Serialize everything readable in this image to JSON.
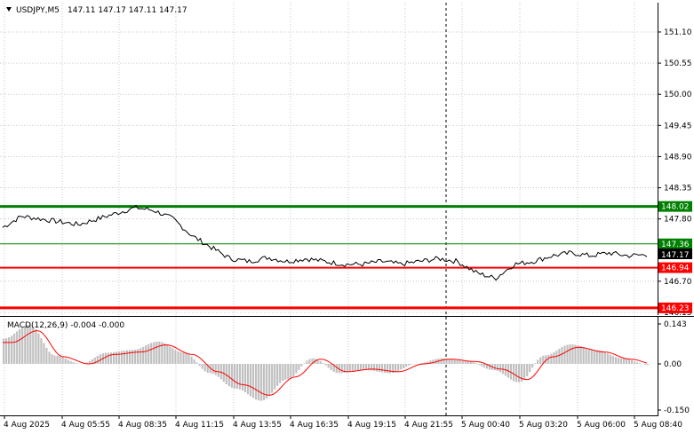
{
  "header": {
    "symbol": "USDJPY,M5",
    "ohlc": "147.11 147.17 147.11 147.17",
    "menu_icon": "triangle-down-icon"
  },
  "indicator": {
    "label": "MACD(12,26,9) -0.004 -0.000",
    "axis_labels": [
      "0.143",
      "0.00",
      "-0.150"
    ]
  },
  "price_axis": {
    "labels": [
      "151.10",
      "150.55",
      "150.00",
      "149.45",
      "148.90",
      "148.35",
      "147.80",
      "146.70",
      "146.15"
    ],
    "current_price": "147.17"
  },
  "levels": [
    {
      "label": "148.02",
      "color": "#008000",
      "width": 3
    },
    {
      "label": "147.36",
      "color": "#008000",
      "width": 1
    },
    {
      "label": "146.94",
      "color": "#ff0000",
      "width": 2
    },
    {
      "label": "146.23",
      "color": "#ff0000",
      "width": 3
    }
  ],
  "time_axis": {
    "labels": [
      "4 Aug 2025",
      "4 Aug 05:55",
      "4 Aug 08:35",
      "4 Aug 11:15",
      "4 Aug 13:55",
      "4 Aug 16:35",
      "4 Aug 19:15",
      "4 Aug 21:55",
      "5 Aug 00:40",
      "5 Aug 03:20",
      "5 Aug 06:00",
      "5 Aug 08:40"
    ]
  },
  "colors": {
    "price_line": "#000000",
    "histogram": "#c0c0c0",
    "signal": "#ff0000",
    "grid": "#c8c8c8",
    "separator": "#000000"
  },
  "chart_data": {
    "type": "line",
    "title": "USDJPY,M5",
    "ylim": [
      146.15,
      151.3
    ],
    "price_series_keypoints": [
      [
        0,
        147.65
      ],
      [
        1,
        147.85
      ],
      [
        2,
        147.8
      ],
      [
        3,
        147.75
      ],
      [
        4,
        147.7
      ],
      [
        5,
        147.8
      ],
      [
        6,
        147.9
      ],
      [
        7,
        148.0
      ],
      [
        8,
        147.95
      ],
      [
        9,
        147.8
      ],
      [
        10,
        147.5
      ],
      [
        11,
        147.3
      ],
      [
        12,
        147.1
      ],
      [
        13,
        147.05
      ],
      [
        14,
        147.12
      ],
      [
        15,
        147.05
      ],
      [
        16,
        147.1
      ],
      [
        17,
        147.05
      ],
      [
        18,
        147.0
      ],
      [
        19,
        147.0
      ],
      [
        20,
        147.05
      ],
      [
        21,
        147.0
      ],
      [
        22,
        147.05
      ],
      [
        23,
        147.1
      ],
      [
        24,
        147.05
      ],
      [
        25,
        146.85
      ],
      [
        26,
        146.75
      ],
      [
        27,
        147.0
      ],
      [
        28,
        147.05
      ],
      [
        29,
        147.15
      ],
      [
        30,
        147.2
      ],
      [
        31,
        147.15
      ],
      [
        32,
        147.2
      ],
      [
        33,
        147.15
      ],
      [
        34,
        147.17
      ]
    ],
    "macd_series_keypoints": [
      [
        0,
        0.09
      ],
      [
        1,
        0.14
      ],
      [
        2,
        0.03
      ],
      [
        3,
        0.0
      ],
      [
        4,
        0.04
      ],
      [
        5,
        0.05
      ],
      [
        6,
        0.08
      ],
      [
        7,
        0.04
      ],
      [
        8,
        -0.03
      ],
      [
        9,
        -0.08
      ],
      [
        10,
        -0.12
      ],
      [
        11,
        -0.05
      ],
      [
        12,
        0.02
      ],
      [
        13,
        -0.03
      ],
      [
        14,
        -0.02
      ],
      [
        15,
        -0.03
      ],
      [
        16,
        0.0
      ],
      [
        17,
        0.02
      ],
      [
        18,
        0.01
      ],
      [
        19,
        -0.02
      ],
      [
        20,
        -0.06
      ],
      [
        21,
        0.03
      ],
      [
        22,
        0.07
      ],
      [
        23,
        0.05
      ],
      [
        24,
        0.02
      ],
      [
        25,
        -0.003
      ]
    ],
    "macd_ylim": [
      -0.165,
      0.16
    ]
  }
}
